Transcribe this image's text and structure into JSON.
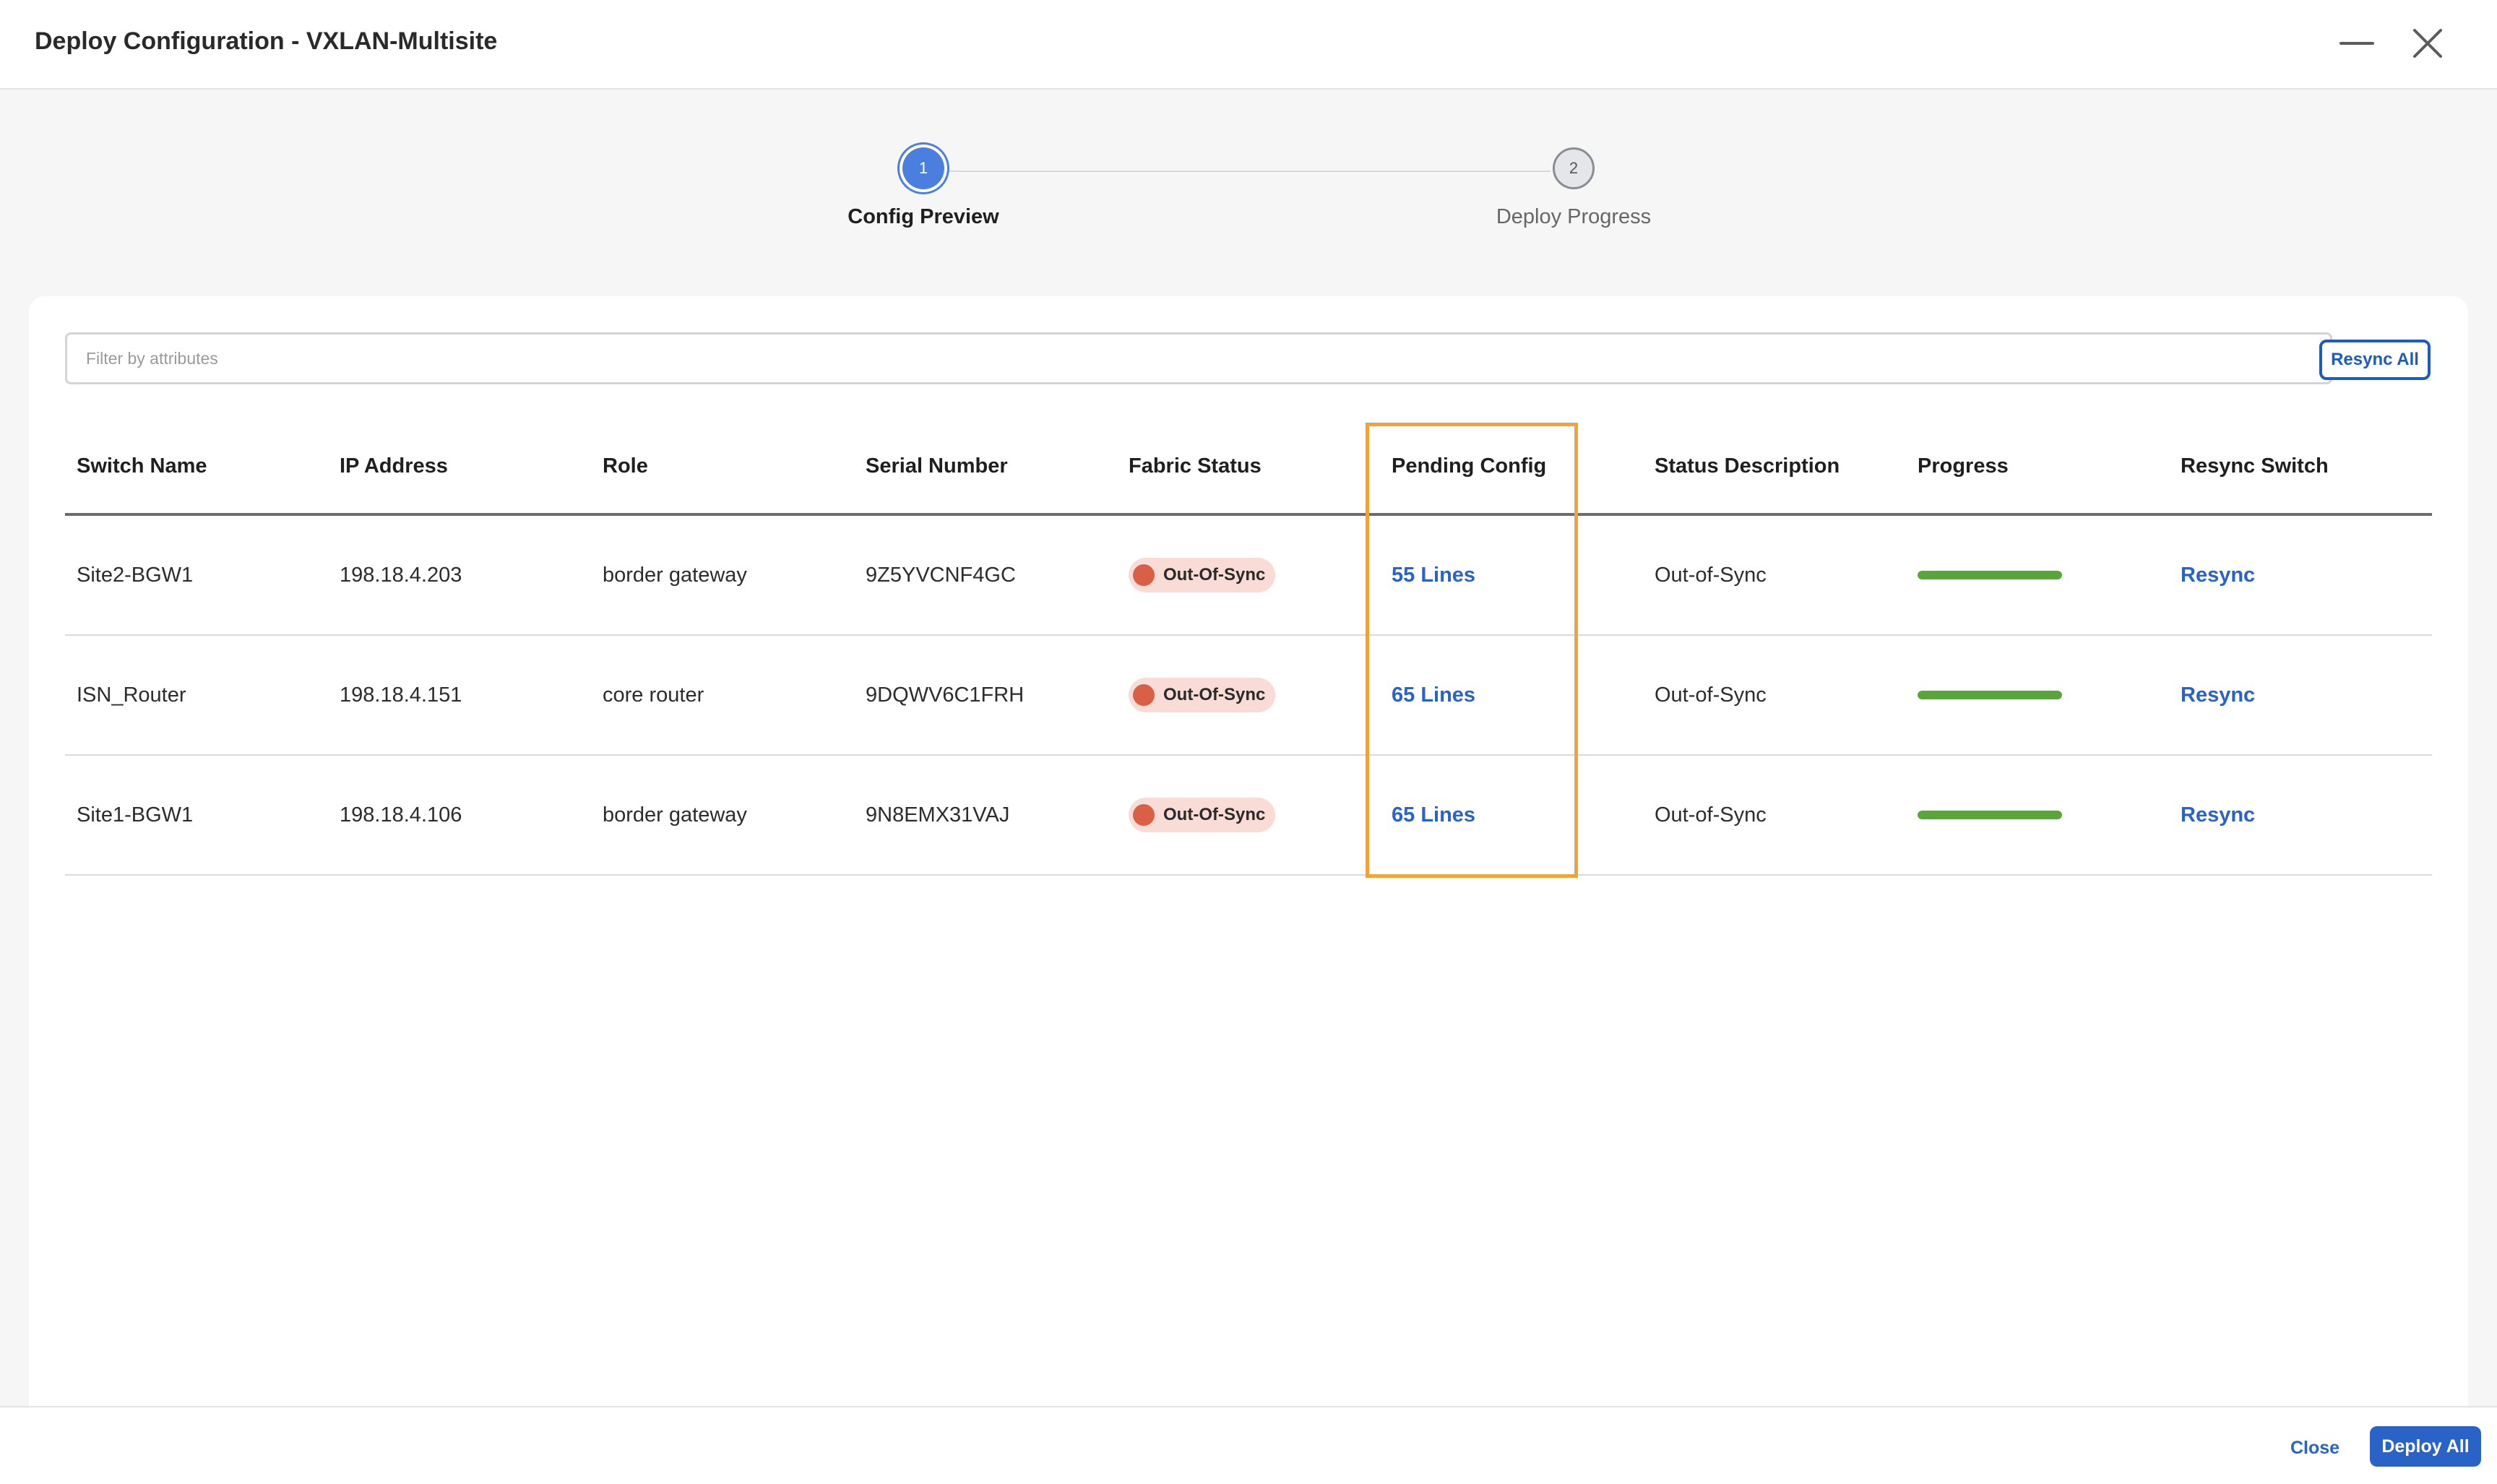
{
  "window": {
    "title": "Deploy Configuration - VXLAN-Multisite",
    "minimize_icon": "minimize-icon",
    "close_icon": "close-icon"
  },
  "stepper": {
    "steps": [
      {
        "number": "1",
        "label": "Config Preview",
        "state": "active"
      },
      {
        "number": "2",
        "label": "Deploy Progress",
        "state": "inactive"
      }
    ]
  },
  "filter": {
    "placeholder": "Filter by attributes",
    "value": ""
  },
  "toolbar": {
    "resync_all_label": "Resync All"
  },
  "table": {
    "columns": [
      "Switch Name",
      "IP Address",
      "Role",
      "Serial Number",
      "Fabric Status",
      "Pending Config",
      "Status Description",
      "Progress",
      "Resync Switch"
    ],
    "rows": [
      {
        "switch_name": "Site2-BGW1",
        "ip": "198.18.4.203",
        "role": "border gateway",
        "serial": "9Z5YVCNF4GC",
        "fabric_status": "Out-Of-Sync",
        "pending_config": "55 Lines",
        "status_description": "Out-of-Sync",
        "progress": 1.0,
        "resync": "Resync"
      },
      {
        "switch_name": "ISN_Router",
        "ip": "198.18.4.151",
        "role": "core router",
        "serial": "9DQWV6C1FRH",
        "fabric_status": "Out-Of-Sync",
        "pending_config": "65 Lines",
        "status_description": "Out-of-Sync",
        "progress": 1.0,
        "resync": "Resync"
      },
      {
        "switch_name": "Site1-BGW1",
        "ip": "198.18.4.106",
        "role": "border gateway",
        "serial": "9N8EMX31VAJ",
        "fabric_status": "Out-Of-Sync",
        "pending_config": "65 Lines",
        "status_description": "Out-of-Sync",
        "progress": 1.0,
        "resync": "Resync"
      }
    ]
  },
  "colors": {
    "accent": "#2a63c7",
    "highlight": "#f0a33a",
    "status_out_of_sync": "#d95f45",
    "progress": "#5aa53a"
  },
  "footer": {
    "close_label": "Close",
    "deploy_all_label": "Deploy All"
  }
}
